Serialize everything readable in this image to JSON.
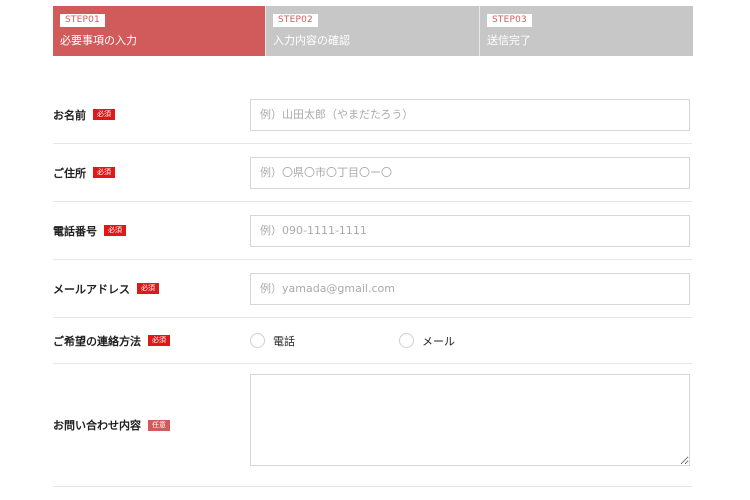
{
  "steps": [
    {
      "tag": "STEP01",
      "label": "必要事項の入力",
      "active": true
    },
    {
      "tag": "STEP02",
      "label": "入力内容の確認",
      "active": false
    },
    {
      "tag": "STEP03",
      "label": "送信完了",
      "active": false
    }
  ],
  "form": {
    "name": {
      "label": "お名前",
      "badge": "必須",
      "placeholder": "例）山田太郎（やまだたろう）",
      "value": ""
    },
    "address": {
      "label": "ご住所",
      "badge": "必須",
      "placeholder": "例）〇県〇市〇丁目〇ー〇",
      "value": ""
    },
    "phone": {
      "label": "電話番号",
      "badge": "必須",
      "placeholder": "例）090-1111-1111",
      "value": ""
    },
    "email": {
      "label": "メールアドレス",
      "badge": "必須",
      "placeholder": "例）yamada@gmail.com",
      "value": ""
    },
    "contact_method": {
      "label": "ご希望の連絡方法",
      "badge": "必須",
      "options": [
        "電話",
        "メール"
      ],
      "selected": null
    },
    "inquiry": {
      "label": "お問い合わせ内容",
      "badge": "任意",
      "value": ""
    }
  },
  "colors": {
    "active_step": "#d15a5a",
    "inactive_step": "#c7c7c7",
    "required_badge": "#e01818",
    "optional_badge": "#d15a5a"
  }
}
